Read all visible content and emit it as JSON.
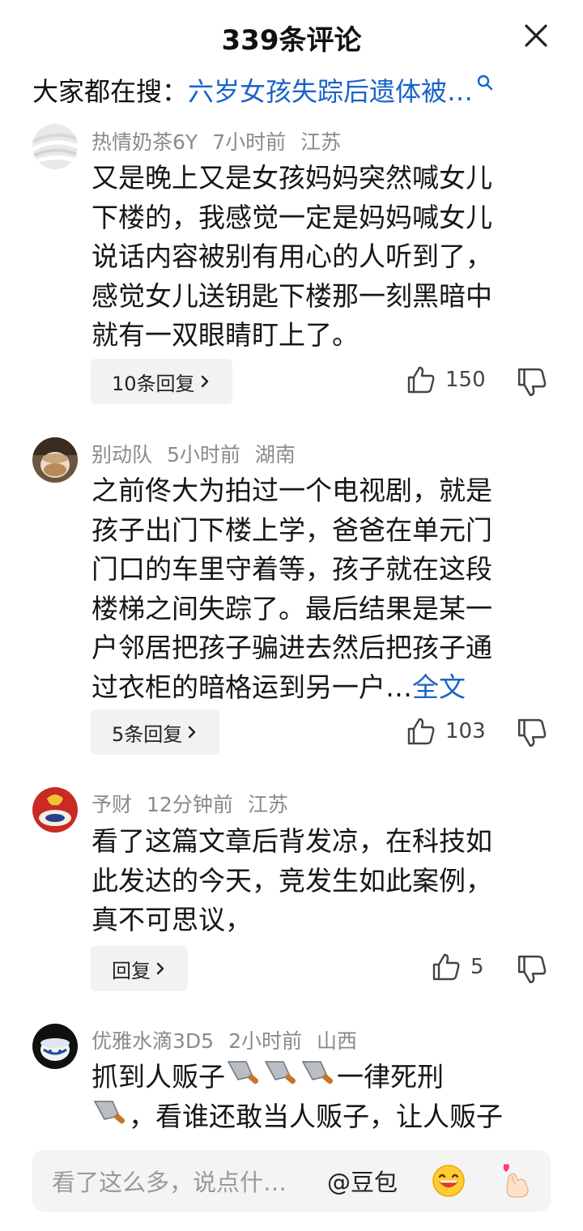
{
  "header": {
    "title": "339条评论"
  },
  "search": {
    "prefix": "大家都在搜：",
    "query": "六岁女孩失踪后遗体被…"
  },
  "comments": [
    {
      "user": "热情奶茶6Y",
      "time": "7小时前",
      "location": "江苏",
      "lines": [
        "又是晚上又是女孩妈妈突然喊女儿",
        "下楼的，我感觉一定是妈妈喊女儿",
        "说话内容被别有用心的人听到了，",
        "感觉女儿送钥匙下楼那一刻黑暗中",
        "就有一双眼睛盯上了。"
      ],
      "reply_label": "10条回复",
      "likes": "150"
    },
    {
      "user": "别动队",
      "time": "5小时前",
      "location": "湖南",
      "lines": [
        "之前佟大为拍过一个电视剧，就是",
        "孩子出门下楼上学，爸爸在单元门",
        "门口的车里守着等，孩子就在这段",
        "楼梯之间失踪了。最后结果是某一",
        "户邻居把孩子骗进去然后把孩子通",
        "过衣柜的暗格运到另一户…"
      ],
      "more_label": "全文",
      "reply_label": "5条回复",
      "likes": "103"
    },
    {
      "user": "予财",
      "time": "12分钟前",
      "location": "江苏",
      "lines": [
        "看了这篇文章后背发凉，在科技如",
        "此发达的今天，竞发生如此案例，",
        "真不可思议，"
      ],
      "reply_label": "回复",
      "likes": "5"
    },
    {
      "user": "优雅水滴3D5",
      "time": "2小时前",
      "location": "山西",
      "line1_a": "抓到人贩子",
      "line1_b": "一律死刑",
      "line2": "，看谁还敢当人贩子，让人贩子"
    }
  ],
  "input": {
    "placeholder": "看了这么多，说点什…",
    "at_label": "@豆包"
  },
  "icons": {
    "close": "close-icon",
    "search": "search-icon",
    "like": "thumbs-up-icon",
    "dislike": "thumbs-down-icon",
    "chevron": "chevron-right-icon",
    "knife": "kitchen-knife-emoji",
    "emoji": "grinning-emoji-icon",
    "gift": "finger-heart-icon"
  },
  "colors": {
    "link": "#1a63c9",
    "meta": "#8a8a8a",
    "reply_bg": "#f2f2f3"
  }
}
